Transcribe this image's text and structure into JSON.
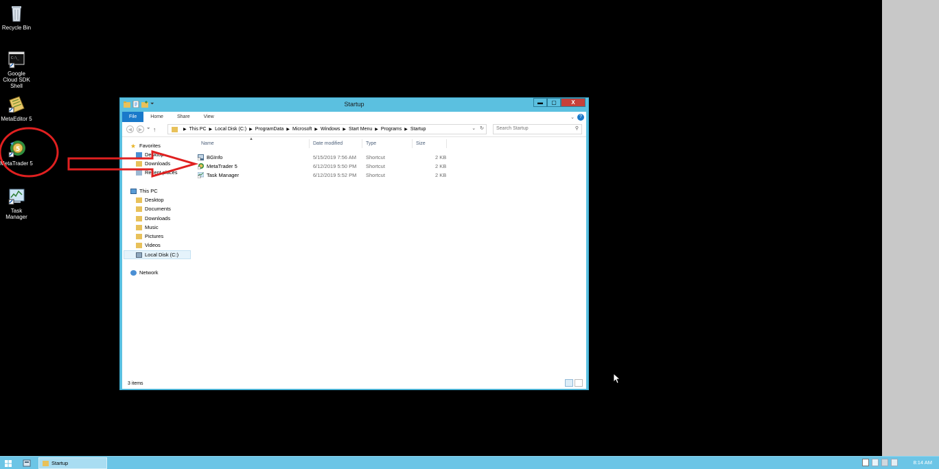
{
  "desktop": {
    "icons": [
      {
        "label": "Recycle Bin",
        "icon": "recycle-bin-icon"
      },
      {
        "label": "Google Cloud SDK Shell",
        "icon": "terminal-icon"
      },
      {
        "label": "MetaEditor 5",
        "icon": "metaeditor-icon"
      },
      {
        "label": "MetaTrader 5",
        "icon": "metatrader-icon"
      },
      {
        "label": "Task Manager",
        "icon": "task-manager-icon"
      }
    ]
  },
  "window": {
    "title": "Startup",
    "controls": {
      "minimize": "▬",
      "maximize": "▢",
      "close": "X"
    },
    "ribbon_tabs": [
      "File",
      "Home",
      "Share",
      "View"
    ],
    "ribbon_expand": "⌄",
    "help": "?",
    "address": [
      "This PC",
      "Local Disk (C:)",
      "ProgramData",
      "Microsoft",
      "Windows",
      "Start Menu",
      "Programs",
      "Startup"
    ],
    "search_placeholder": "Search Startup",
    "nav_pane": {
      "favorites": "Favorites",
      "favorite_items": [
        "Desktop",
        "Downloads",
        "Recent places"
      ],
      "this_pc": "This PC",
      "pc_items": [
        "Desktop",
        "Documents",
        "Downloads",
        "Music",
        "Pictures",
        "Videos",
        "Local Disk (C:)"
      ],
      "network": "Network"
    },
    "columns": [
      "Name",
      "Date modified",
      "Type",
      "Size"
    ],
    "files": [
      {
        "name": "BGInfo",
        "date": "5/15/2019 7:56 AM",
        "type": "Shortcut",
        "size": "2 KB"
      },
      {
        "name": "MetaTrader 5",
        "date": "6/12/2019 5:50 PM",
        "type": "Shortcut",
        "size": "2 KB"
      },
      {
        "name": "Task Manager",
        "date": "6/12/2019 5:52 PM",
        "type": "Shortcut",
        "size": "2 KB"
      }
    ],
    "status": "3 items"
  },
  "taskbar": {
    "task_label": "Startup",
    "clock": "8:14 AM"
  },
  "colors": {
    "window_frame": "#5bc0e0",
    "taskbar": "#6cc5e6",
    "annotation_red": "#e02020",
    "file_tab": "#1979ca"
  }
}
